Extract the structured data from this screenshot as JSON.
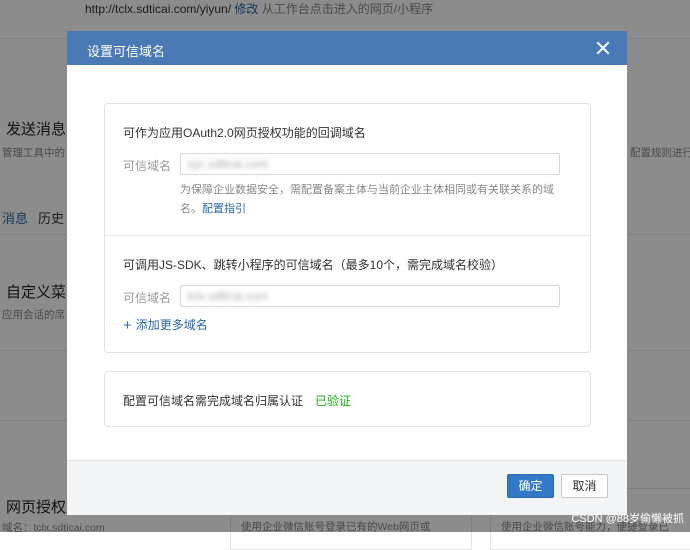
{
  "background": {
    "url_text": "http://tclx.sdticai.com/yiyun/",
    "modify_link": "修改",
    "url_hint": "从工作台点击进入的网页/小程序",
    "send_message": "发送消息",
    "send_message_sub": "管理工具中的",
    "right_sub": "配置规则进行",
    "tab_messages": "消息",
    "tab_history": "历史",
    "custom_menu": "自定义菜",
    "custom_menu_sub": "应用会话的席",
    "web_auth": "网页授权及",
    "web_auth_sub": "域名：tclx.sdticai.com",
    "card_sub_1": "使用企业微信账号登录已有的Web网页或",
    "card_sub_2": "使用企业微信账号能力，便捷登录已",
    "watermark": "CSDN @88岁偷懒被抓"
  },
  "dialog": {
    "title": "设置可信域名",
    "section_oauth": {
      "title": "可作为应用OAuth2.0网页授权功能的回调域名",
      "field_label": "可信域名",
      "field_value": "xyc.sdticai.com",
      "hint_text": "为保障企业数据安全，需配置备案主体与当前企业主体相同或有关联关系的域名。",
      "hint_link": "配置指引"
    },
    "section_jssdk": {
      "title": "可调用JS-SDK、跳转小程序的可信域名（最多10个，需完成域名校验）",
      "field_label": "可信域名",
      "field_value": "tclx.sdticai.com",
      "add_more": "添加更多域名"
    },
    "section_verify": {
      "text": "配置可信域名需完成域名归属认证",
      "status": "已验证"
    },
    "buttons": {
      "ok": "确定",
      "cancel": "取消"
    }
  },
  "colors": {
    "header": "#4a7ab5",
    "primary_button": "#3478c8",
    "link": "#2b6aa8",
    "verified": "#1aad19"
  }
}
